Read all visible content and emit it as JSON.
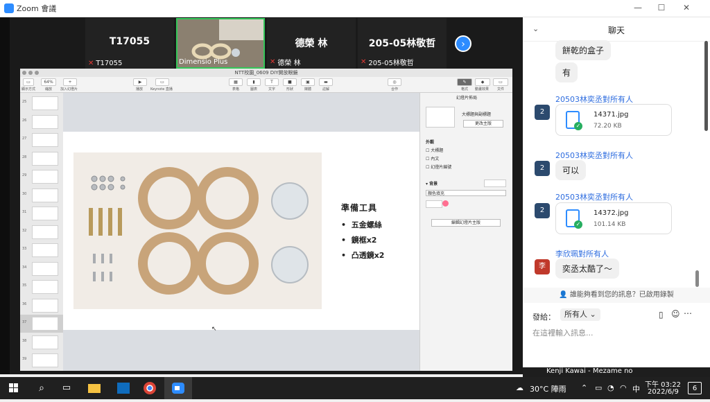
{
  "window": {
    "title": "Zoom 會議",
    "minimize": "—",
    "maximize": "☐",
    "close": "✕"
  },
  "video_tiles": [
    {
      "big": "T17055",
      "name": "T17055"
    },
    {
      "big": "",
      "name": "Dimensio Plus"
    },
    {
      "big": "德榮 林",
      "name": "德榮 林"
    },
    {
      "big": "205-05林敬哲",
      "name": "205-05林敬哲"
    }
  ],
  "next_button": "›",
  "keynote": {
    "window_title": "NTT校園_0609 DIY開放眼鏡",
    "zoom_value": "64%",
    "toolbar_left": [
      "顯示方式",
      "縮放",
      "加入幻燈片"
    ],
    "toolbar_mid_left": [
      "播放",
      "Keynote 直播"
    ],
    "toolbar_mid": [
      "表格",
      "圖表",
      "文字",
      "形狀",
      "媒體",
      "註解"
    ],
    "toolbar_mid_right": "合作",
    "toolbar_right": [
      "格式",
      "動畫效果",
      "文件"
    ],
    "slide_numbers": [
      "25",
      "26",
      "27",
      "28",
      "29",
      "30",
      "31",
      "32",
      "33",
      "34",
      "35",
      "36",
      "37",
      "38",
      "39"
    ],
    "slide": {
      "heading": "準備工具",
      "bullets": [
        "五金螺絲",
        "鏡框x2",
        "凸透鏡x2"
      ]
    },
    "format_panel": {
      "tab": "幻燈片佈局",
      "layout_name": "大標題與副標題",
      "change_master": "更改主版",
      "appearance": "外觀",
      "checkbox_title": "大標題",
      "checkbox_body": "內文",
      "checkbox_number": "幻燈片編號",
      "background": "背景",
      "fill": "顏色填充",
      "edit_master": "編輯幻燈片主版"
    }
  },
  "chat": {
    "header": "聊天",
    "collapse_icon": "chevron-down-icon",
    "messages": [
      {
        "type": "text",
        "text": "餅乾的盒子"
      },
      {
        "type": "text",
        "text": "有"
      },
      {
        "sender": "20503林奕丞對所有人",
        "avatar": "2",
        "type": "file",
        "file": "14371.jpg",
        "size": "72.20 KB"
      },
      {
        "sender": "20503林奕丞對所有人",
        "avatar": "2",
        "type": "text",
        "text": "可以"
      },
      {
        "sender": "20503林奕丞對所有人",
        "avatar": "2",
        "type": "file",
        "file": "14372.jpg",
        "size": "101.14 KB"
      },
      {
        "sender": "李欣珮對所有人",
        "avatar": "李",
        "type": "text",
        "text": "奕丞太酷了～"
      }
    ],
    "notice": "誰能夠看到您的訊息？已啟用錄製",
    "send_to_label": "發給：",
    "send_to_value": "所有人",
    "input_placeholder": "在這裡輸入訊息..."
  },
  "overlay_text": "Kenji Kawai - Mezame no",
  "taskbar": {
    "weather": "30°C  陣雨",
    "ime": "中",
    "time": "下午 03:22",
    "date": "2022/6/9",
    "notifications": "6"
  },
  "colors": {
    "zoom_blue": "#2d8cff",
    "avatar_blue": "#2c4a6e",
    "avatar_red": "#c0392b"
  }
}
